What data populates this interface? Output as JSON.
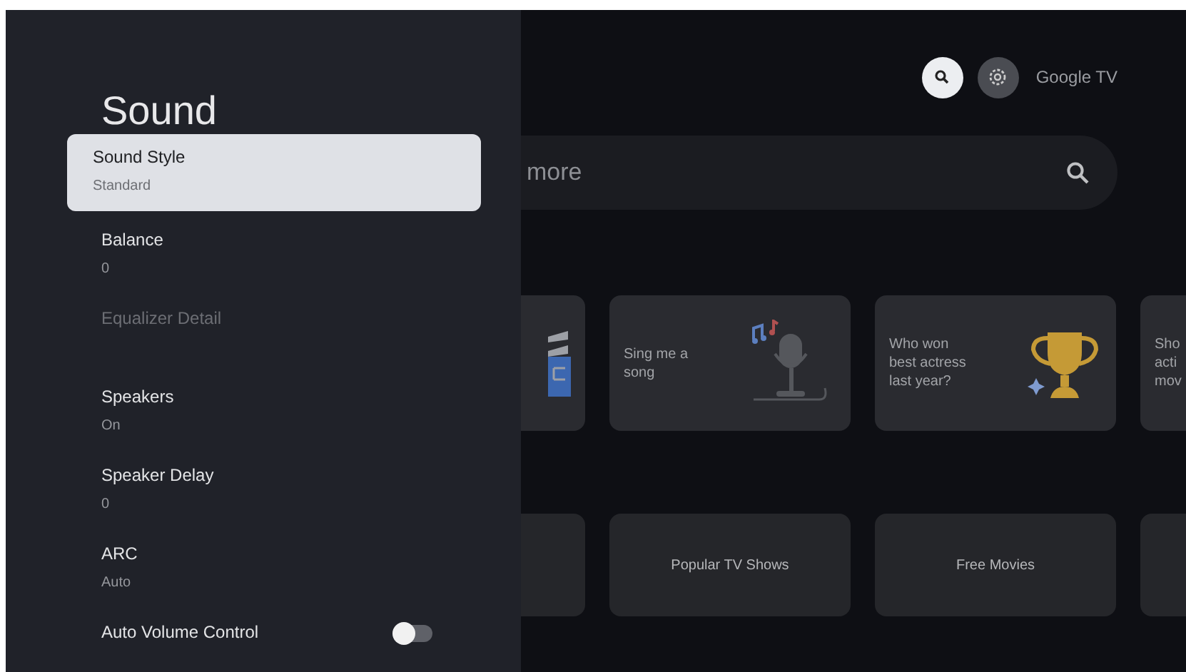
{
  "panel": {
    "title": "Sound",
    "items": [
      {
        "kind": "value",
        "label": "Sound Style",
        "value": "Standard",
        "selected": true,
        "disabled": false
      },
      {
        "kind": "value",
        "label": "Balance",
        "value": "0",
        "selected": false,
        "disabled": false
      },
      {
        "kind": "value",
        "label": "Equalizer Detail",
        "selected": false,
        "disabled": true
      },
      {
        "kind": "value",
        "label": "Speakers",
        "value": "On",
        "selected": false,
        "disabled": false
      },
      {
        "kind": "value",
        "label": "Speaker Delay",
        "value": "0",
        "selected": false,
        "disabled": false
      },
      {
        "kind": "value",
        "label": "ARC",
        "value": "Auto",
        "selected": false,
        "disabled": false
      },
      {
        "kind": "toggle",
        "label": "Auto Volume Control",
        "on": false,
        "selected": false,
        "disabled": false
      }
    ]
  },
  "header": {
    "brand": "Google TV"
  },
  "search": {
    "placeholder": "more"
  },
  "suggestions": [
    {
      "kind": "cut"
    },
    {
      "kind": "mic",
      "lines": [
        "Sing me a",
        "song"
      ]
    },
    {
      "kind": "trophy",
      "lines": [
        "Who won",
        "best actress",
        "last year?"
      ]
    },
    {
      "kind": "cut",
      "lines": [
        "Sho",
        "acti",
        "mov"
      ]
    }
  ],
  "collections": [
    {
      "kind": "cut"
    },
    {
      "kind": "tile",
      "label": "Popular TV Shows"
    },
    {
      "kind": "tile",
      "label": "Free Movies"
    },
    {
      "kind": "cut"
    }
  ]
}
